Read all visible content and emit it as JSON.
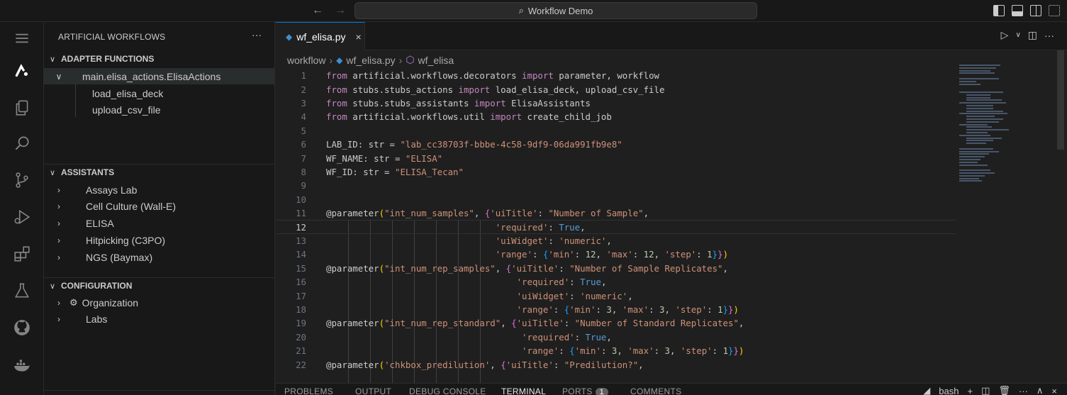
{
  "window": {
    "search_label": "Workflow Demo",
    "back_icon": "arrow-left-icon",
    "forward_icon": "arrow-right-icon"
  },
  "activity_bar": [
    {
      "name": "menu-icon"
    },
    {
      "name": "artificial-logo-icon"
    },
    {
      "name": "explorer-icon"
    },
    {
      "name": "search-icon"
    },
    {
      "name": "source-control-icon"
    },
    {
      "name": "run-debug-icon"
    },
    {
      "name": "extensions-icon"
    },
    {
      "name": "flask-icon"
    },
    {
      "name": "github-icon"
    },
    {
      "name": "docker-icon"
    }
  ],
  "sidebar": {
    "title": "ARTIFICIAL WORKFLOWS",
    "more": "···",
    "adapter_functions": {
      "header": "ADAPTER FUNCTIONS",
      "parent": "main.elisa_actions.ElisaActions",
      "children": [
        "load_elisa_deck",
        "upload_csv_file"
      ]
    },
    "assistants": {
      "header": "ASSISTANTS",
      "items": [
        "Assays Lab",
        "Cell Culture (Wall-E)",
        "ELISA",
        "Hitpicking (C3PO)",
        "NGS (Baymax)"
      ]
    },
    "configuration": {
      "header": "CONFIGURATION",
      "items": [
        "Organization",
        "Labs"
      ]
    }
  },
  "editor": {
    "tab_label": "wf_elisa.py",
    "close_glyph": "×",
    "breadcrumb": [
      "workflow",
      "wf_elisa.py",
      "wf_elisa"
    ],
    "current_line": 12,
    "line_numbers": [
      "1",
      "2",
      "3",
      "4",
      "5",
      "6",
      "7",
      "8",
      "9",
      "10",
      "11",
      "12",
      "13",
      "14",
      "15",
      "16",
      "17",
      "18",
      "19",
      "20",
      "21",
      "22"
    ]
  },
  "panel": {
    "tabs": [
      "PROBLEMS",
      "OUTPUT",
      "DEBUG CONSOLE",
      "TERMINAL",
      "PORTS",
      "COMMENTS"
    ],
    "active_tab": "TERMINAL",
    "ports_badge": "1",
    "terminal_name": "bash"
  },
  "colors": {
    "accent": "#0078d4",
    "keyword": "#c586c0",
    "string": "#ce9178",
    "number": "#b5cea8",
    "constant": "#569cd6"
  }
}
